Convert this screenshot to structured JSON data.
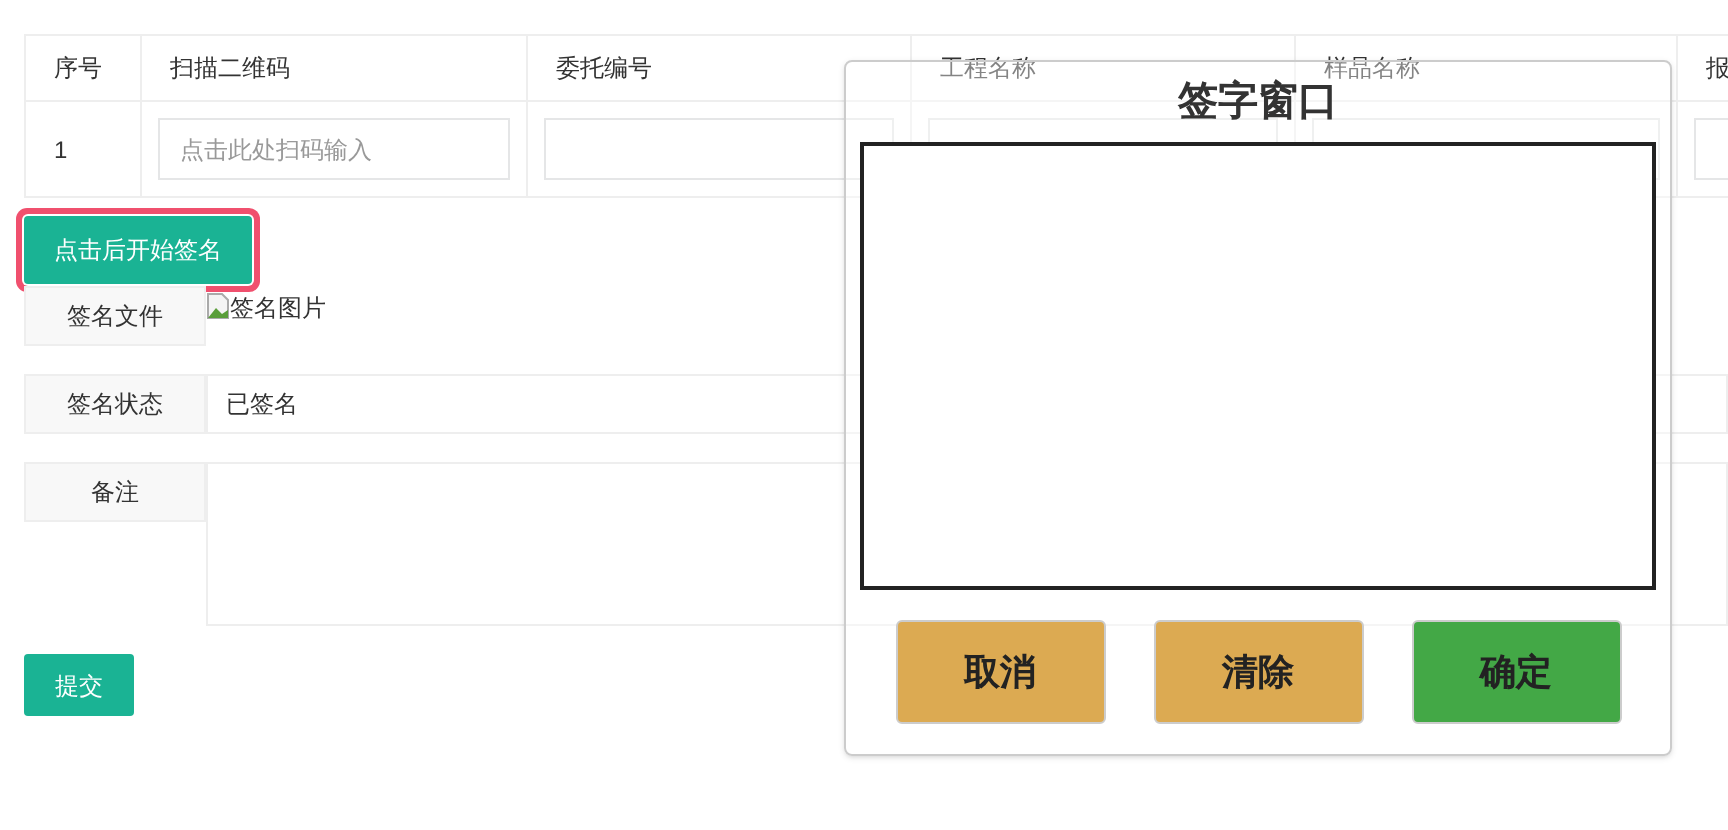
{
  "table": {
    "columns": [
      "序号",
      "扫描二维码",
      "委托编号",
      "工程名称",
      "样品名称",
      "报"
    ],
    "rows": [
      {
        "index": "1",
        "qr_placeholder": "点击此处扫码输入"
      }
    ]
  },
  "start_sign_button": {
    "label": "点击后开始签名",
    "highlighted": true
  },
  "form": [
    {
      "kind": "image",
      "label": "签名文件",
      "value": "签名图片"
    },
    {
      "kind": "text",
      "label": "签名状态",
      "value": "已签名"
    },
    {
      "kind": "textarea",
      "label": "备注"
    }
  ],
  "submit_button": "提交",
  "dialog": {
    "title": "签字窗口",
    "buttons": [
      {
        "label": "取消",
        "color": "#dcaa52"
      },
      {
        "label": "清除",
        "color": "#dcaa52"
      },
      {
        "label": "确定",
        "color": "#43a846"
      }
    ]
  }
}
